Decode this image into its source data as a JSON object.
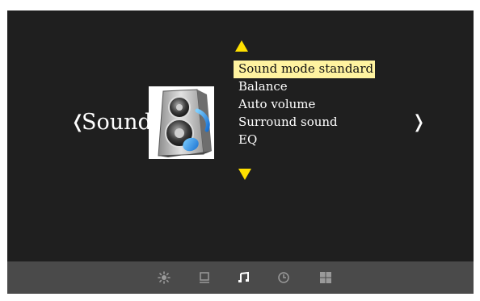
{
  "menu": {
    "category": "Sound",
    "nav_prev": "❬",
    "nav_next": "❭",
    "options": [
      {
        "label": "Sound mode standard",
        "selected": true
      },
      {
        "label": "Balance",
        "selected": false
      },
      {
        "label": "Auto volume",
        "selected": false
      },
      {
        "label": "Surround sound",
        "selected": false
      },
      {
        "label": "EQ",
        "selected": false
      }
    ]
  },
  "tabs": [
    {
      "icon": "brightness-icon",
      "active": false
    },
    {
      "icon": "screen-icon",
      "active": false
    },
    {
      "icon": "music-note-icon",
      "active": true
    },
    {
      "icon": "clock-icon",
      "active": false
    },
    {
      "icon": "grid-icon",
      "active": false
    }
  ],
  "colors": {
    "background": "#1f1f1f",
    "bottom_bar": "#4a4a4a",
    "highlight": "#fff3a0",
    "arrow": "#ffe000",
    "inactive_icon": "#9a9a9a",
    "active_icon": "#ffffff"
  }
}
